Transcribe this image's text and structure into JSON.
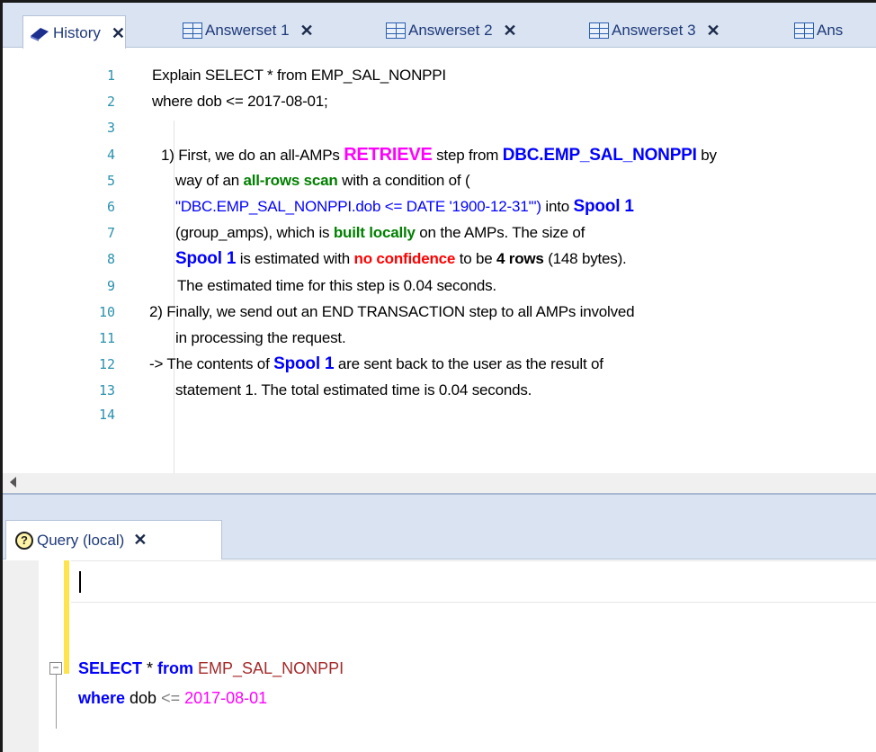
{
  "tabs": [
    {
      "label": "History",
      "icon": "book-icon",
      "active": true
    },
    {
      "label": "Answerset 1",
      "icon": "grid-icon"
    },
    {
      "label": "Answerset 2",
      "icon": "grid-icon"
    },
    {
      "label": "Answerset 3",
      "icon": "grid-icon"
    },
    {
      "label": "Ans",
      "icon": "grid-icon"
    }
  ],
  "close_glyph": "✕",
  "editor": {
    "line_numbers": [
      "1",
      "2",
      "3",
      "4",
      "5",
      "6",
      "7",
      "8",
      "9",
      "10",
      "11",
      "12",
      "13",
      "14"
    ],
    "l1": "Explain SELECT * from EMP_SAL_NONPPI",
    "l2": "where dob <= 2017-08-01;",
    "l4": {
      "a": "1) First, we do an all-AMPs ",
      "b": "RETRIEVE",
      "c": " step from ",
      "d": "DBC.EMP_SAL_NONPPI",
      "e": " by"
    },
    "l5": {
      "a": "way of an ",
      "b": "all-rows scan",
      "c": " with a condition of ("
    },
    "l6": {
      "a": "\"DBC.EMP_SAL_NONPPI.dob <= DATE '1900-12-31'\")",
      "b": " into ",
      "c": "Spool  1"
    },
    "l7": {
      "a": "(group_amps), which is ",
      "b": "built locally",
      "c": " on the AMPs.  The size of"
    },
    "l8": {
      "a": "Spool  1",
      "b": " is estimated with ",
      "c": "no confidence",
      "d": " to be ",
      "e": "4 rows",
      "f": " (148 bytes)."
    },
    "l9": "The estimated time for this step is 0.04 seconds.",
    "l10": "2) Finally, we send out an END TRANSACTION step to all AMPs involved",
    "l11": "in processing the request.",
    "l12": {
      "a": "-> The contents of ",
      "b": "Spool  1",
      "c": " are sent back to the user as the result of"
    },
    "l13": "statement 1.  The total estimated time is 0.04 seconds."
  },
  "query_tab": {
    "label": "Query (local)",
    "icon": "help-icon",
    "icon_text": "?"
  },
  "query": {
    "select": "SELECT",
    "star": " * ",
    "from": "from",
    "table": " EMP_SAL_NONPPI",
    "where": "where",
    "col": " dob ",
    "op": "<=",
    "val": " 2017-08-01"
  },
  "colors": {
    "line_number": "#2b91af",
    "keyword_blue": "#0000ff",
    "keyword_magenta": "#ff00ff",
    "keyword_green": "#008000",
    "keyword_red": "#ff0000",
    "tab_bg": "#d9e3f1"
  }
}
